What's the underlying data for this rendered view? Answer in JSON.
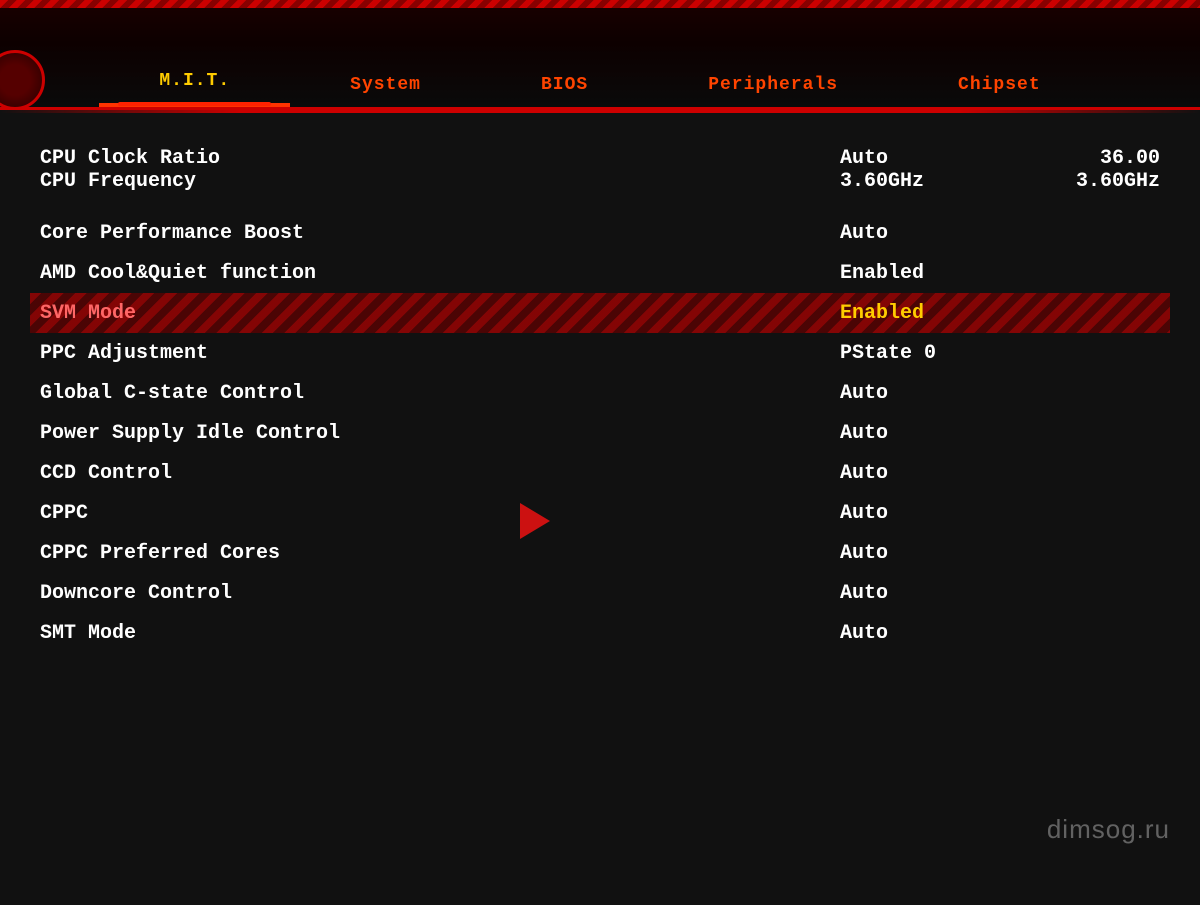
{
  "tabs": [
    {
      "label": "M.I.T.",
      "active": true
    },
    {
      "label": "System",
      "active": false
    },
    {
      "label": "BIOS",
      "active": false
    },
    {
      "label": "Peripherals",
      "active": false
    },
    {
      "label": "Chipset",
      "active": false
    }
  ],
  "settings": {
    "cpu_clock_ratio": {
      "name": "CPU Clock Ratio",
      "value": "Auto",
      "value2": "36.00"
    },
    "cpu_frequency": {
      "name": "CPU Frequency",
      "value": "3.60GHz",
      "value2": "3.60GHz"
    },
    "core_performance_boost": {
      "name": "Core Performance Boost",
      "value": "Auto",
      "highlighted": false
    },
    "amd_cool_quiet": {
      "name": "AMD Cool&Quiet function",
      "value": "Enabled",
      "highlighted": false
    },
    "svm_mode": {
      "name": "SVM Mode",
      "value": "Enabled",
      "highlighted": true
    },
    "ppc_adjustment": {
      "name": "PPC Adjustment",
      "value": "PState 0",
      "highlighted": false
    },
    "global_cstate": {
      "name": "Global C-state Control",
      "value": "Auto",
      "highlighted": false
    },
    "power_supply_idle": {
      "name": "Power Supply Idle Control",
      "value": "Auto",
      "highlighted": false
    },
    "ccd_control": {
      "name": "CCD Control",
      "value": "Auto",
      "highlighted": false
    },
    "cppc": {
      "name": "CPPC",
      "value": "Auto",
      "highlighted": false
    },
    "cppc_preferred_cores": {
      "name": "CPPC Preferred Cores",
      "value": "Auto",
      "highlighted": false
    },
    "downcore_control": {
      "name": "Downcore Control",
      "value": "Auto",
      "highlighted": false
    },
    "smt_mode": {
      "name": "SMT Mode",
      "value": "Auto",
      "highlighted": false
    }
  },
  "watermark": "dimsog.ru"
}
